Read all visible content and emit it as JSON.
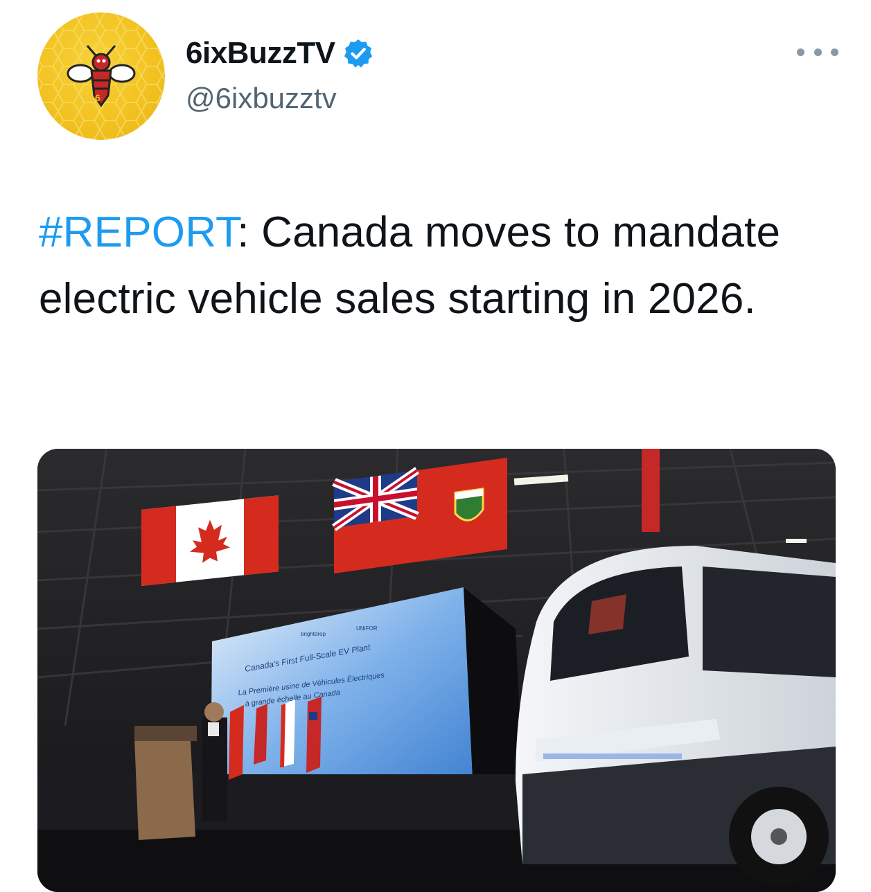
{
  "author": {
    "display_name": "6ixBuzzTV",
    "handle": "@6ixbuzztv",
    "avatar_icon": "bee-logo-icon",
    "verified_icon": "verified-badge-icon",
    "avatar_badge_text": "6"
  },
  "menu": {
    "icon": "more-options-icon"
  },
  "tweet": {
    "hashtag": "#REPORT",
    "body": ": Canada moves to mandate electric vehicle sales starting in 2026."
  },
  "media": {
    "screen_lines": [
      "Canada's First Full-Scale EV Plant",
      "La Première usine de Véhicules Électriques",
      "à grande échelle au Canada"
    ],
    "screen_brand": "UNIFOR",
    "screen_logo_text": "brightdrop"
  },
  "colors": {
    "hashtag": "#1d9bf0",
    "verified": "#1d9bf0",
    "handle": "#536471",
    "avatar": "#f2c11f"
  }
}
